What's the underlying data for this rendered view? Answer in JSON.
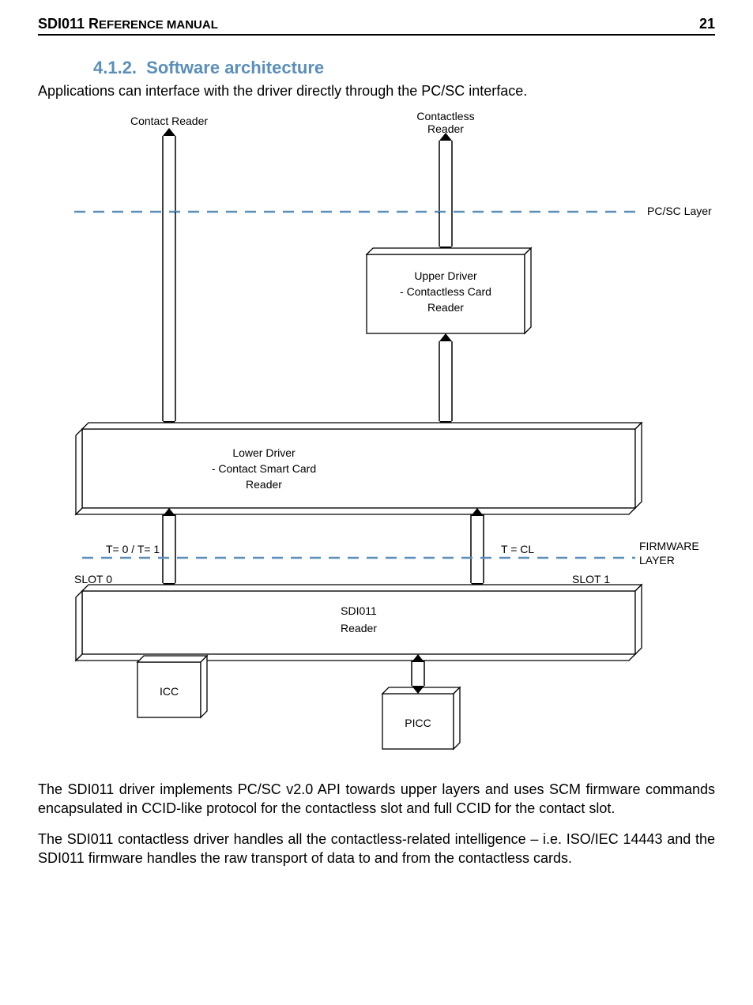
{
  "header": {
    "doc_title_prefix": "SDI011 R",
    "doc_title_rest": "EFERENCE MANUAL",
    "page_number": "21"
  },
  "section": {
    "number": "4.1.2.",
    "title": "Software architecture"
  },
  "intro": "Applications can interface with the driver directly through the PC/SC interface.",
  "diagram": {
    "top_left_label": "Contact Reader",
    "top_right_label_line1": "Contactless",
    "top_right_label_line2": "Reader",
    "pcsc_layer_label": "PC/SC Layer",
    "upper_driver_line1": "Upper Driver",
    "upper_driver_line2": "- Contactless Card",
    "upper_driver_line3": "Reader",
    "lower_driver_line1": "Lower Driver",
    "lower_driver_line2": "- Contact Smart Card",
    "lower_driver_line3": "Reader",
    "t0t1_label": "T= 0 / T= 1",
    "tcl_label": "T = CL",
    "firmware_line1": "FIRMWARE",
    "firmware_line2": "LAYER",
    "slot0_label": "SLOT 0",
    "slot1_label": "SLOT 1",
    "reader_line1": "SDI011",
    "reader_line2": "Reader",
    "icc_label": "ICC",
    "picc_label": "PICC"
  },
  "para1": "The SDI011 driver implements PC/SC v2.0 API towards upper layers and uses SCM firmware commands encapsulated in CCID-like protocol for the contactless slot and full CCID for the contact slot.",
  "para2": "The SDI011 contactless driver handles all the contactless-related intelligence – i.e. ISO/IEC 14443 and the SDI011 firmware handles the raw transport of data to and from the contactless cards."
}
